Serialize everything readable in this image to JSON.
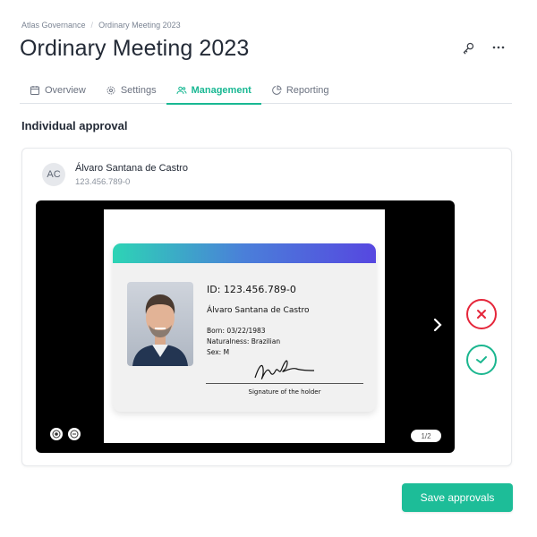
{
  "breadcrumb": [
    "Atlas Governance",
    "Ordinary Meeting 2023"
  ],
  "page_title": "Ordinary Meeting 2023",
  "header_actions": {
    "key_icon": "key-icon",
    "more_icon": "more-horizontal-icon"
  },
  "tabs": [
    {
      "label": "Overview",
      "icon": "calendar-icon",
      "active": false
    },
    {
      "label": "Settings",
      "icon": "gear-icon",
      "active": false
    },
    {
      "label": "Management",
      "icon": "users-icon",
      "active": true
    },
    {
      "label": "Reporting",
      "icon": "pie-chart-icon",
      "active": false
    }
  ],
  "section_title": "Individual approval",
  "person": {
    "initials": "AC",
    "name": "Álvaro Santana de Castro",
    "id": "123.456.789-0"
  },
  "document": {
    "id_line": "ID: 123.456.789-0",
    "name": "Álvaro Santana de Castro",
    "born": "Born: 03/22/1983",
    "naturalness": "Naturalness: Brazilian",
    "sex": "Sex: M",
    "signature_label": "Signature of the holder"
  },
  "viewer": {
    "page_indicator": "1/2"
  },
  "actions": {
    "save_label": "Save approvals"
  },
  "colors": {
    "accent": "#1dbd98",
    "reject": "#e5263a",
    "approve": "#1bb68f"
  }
}
